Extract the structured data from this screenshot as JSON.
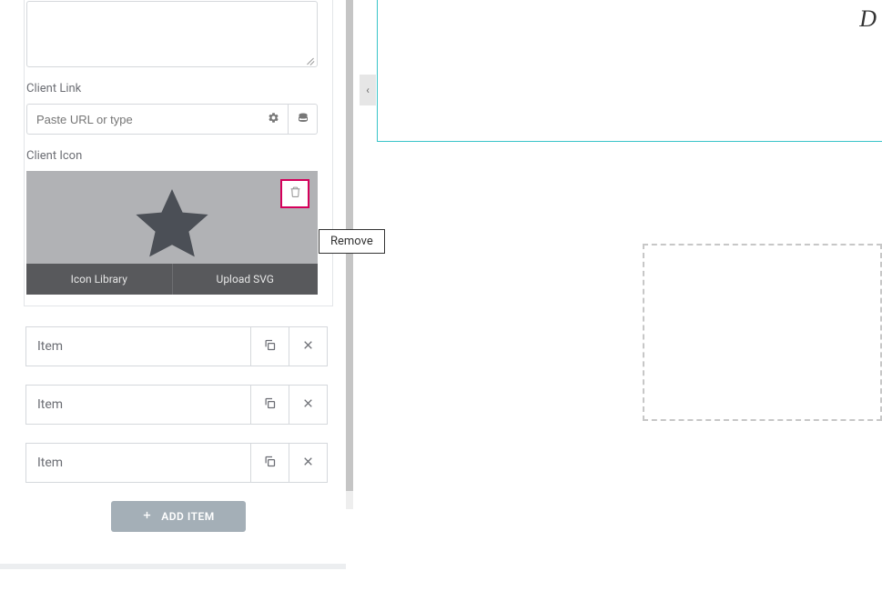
{
  "sidebar": {
    "client_link_label": "Client Link",
    "client_link_placeholder": "Paste URL or type",
    "client_icon_label": "Client Icon",
    "icon_tabs": {
      "library": "Icon Library",
      "upload": "Upload SVG"
    },
    "remove_tooltip": "Remove",
    "items": [
      {
        "label": "Item"
      },
      {
        "label": "Item"
      },
      {
        "label": "Item"
      }
    ],
    "add_button": "ADD ITEM"
  },
  "preview": {
    "corner_letter": "D"
  }
}
